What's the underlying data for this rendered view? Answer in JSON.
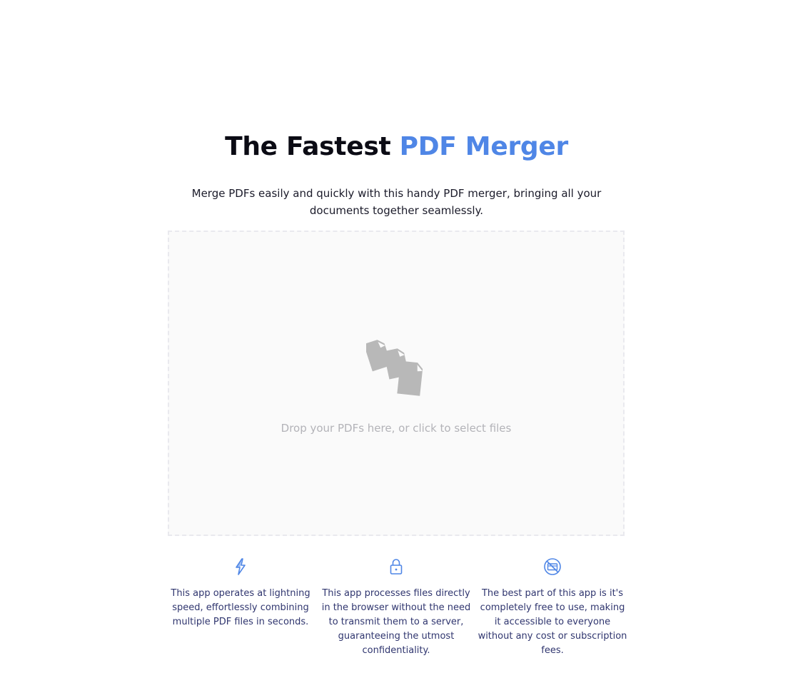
{
  "hero": {
    "title_plain": "The Fastest",
    "title_accent": "PDF Merger",
    "subtitle": "Merge PDFs easily and quickly with this handy PDF merger, bringing all your documents together seamlessly."
  },
  "dropzone": {
    "icon": "stacked-documents-icon",
    "text": "Drop your PDFs here, or click to select files"
  },
  "features": [
    {
      "icon": "lightning-icon",
      "text": "This app operates at lightning speed, effortlessly combining multiple PDF files in seconds."
    },
    {
      "icon": "lock-icon",
      "text": "This app processes files directly in the browser without the need to transmit them to a server, guaranteeing the utmost confidentiality."
    },
    {
      "icon": "no-cost-icon",
      "text": "The best part of this app is it's completely free to use, making it accessible to everyone without any cost or subscription fees."
    }
  ],
  "colors": {
    "accent": "#4f86e6",
    "feature_text": "#30366f",
    "dropzone_bg": "#fafafa",
    "dropzone_text": "#b3b3b8"
  }
}
